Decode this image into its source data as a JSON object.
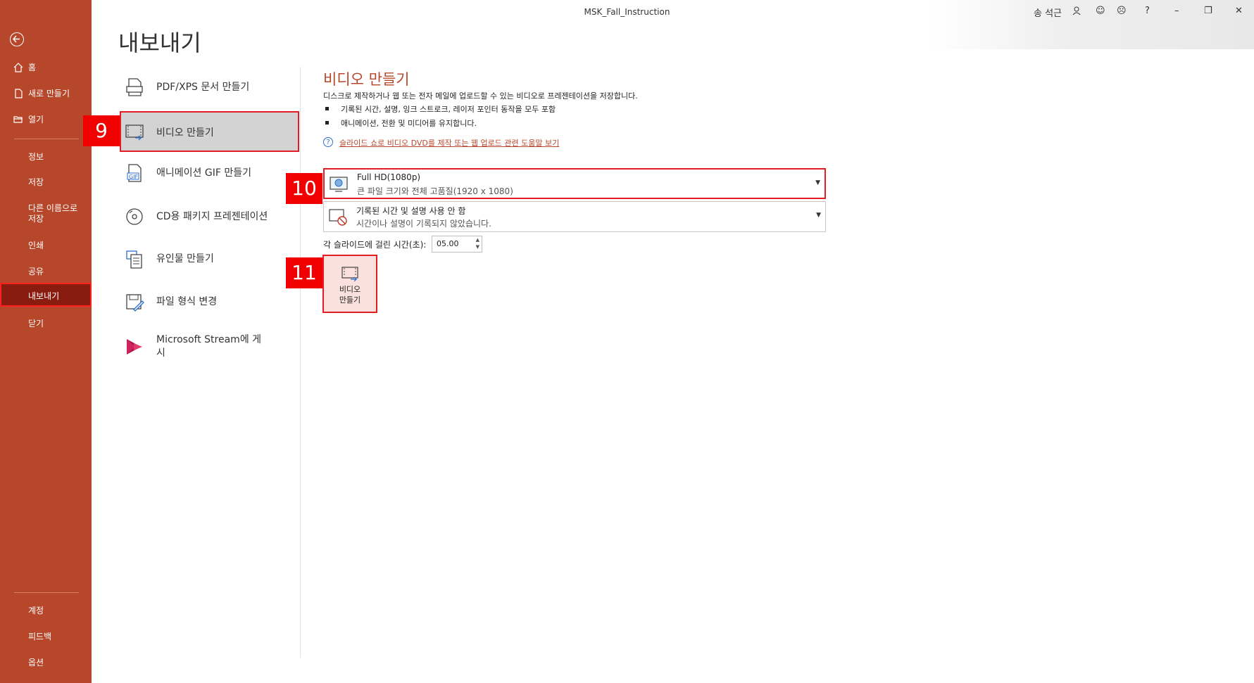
{
  "window": {
    "title": "MSK_Fall_Instruction",
    "user": "송 석근"
  },
  "sidebar": {
    "items": [
      {
        "label": "홈"
      },
      {
        "label": "새로 만들기"
      },
      {
        "label": "열기"
      },
      {
        "label": "정보"
      },
      {
        "label": "저장"
      },
      {
        "label": "다른 이름으로 저장"
      },
      {
        "label": "인쇄"
      },
      {
        "label": "공유"
      },
      {
        "label": "내보내기"
      },
      {
        "label": "닫기"
      }
    ],
    "bottom_items": [
      {
        "label": "계정"
      },
      {
        "label": "피드백"
      },
      {
        "label": "옵션"
      }
    ],
    "active": "내보내기"
  },
  "page": {
    "title": "내보내기"
  },
  "export_options": [
    {
      "label": "PDF/XPS 문서 만들기",
      "icon": "pdf-icon"
    },
    {
      "label": "비디오 만들기",
      "icon": "video-icon"
    },
    {
      "label": "애니메이션 GIF 만들기",
      "icon": "gif-icon"
    },
    {
      "label": "CD용 패키지 프레젠테이션",
      "icon": "cd-icon"
    },
    {
      "label": "유인물 만들기",
      "icon": "handout-icon"
    },
    {
      "label": "파일 형식 변경",
      "icon": "file-type-icon"
    },
    {
      "label": "Microsoft Stream에 게시",
      "icon": "stream-icon"
    }
  ],
  "markers": {
    "m9": "9",
    "m10": "10",
    "m11": "11"
  },
  "video": {
    "title": "비디오 만들기",
    "description": "디스크로 제작하거나 웹 또는 전자 메일에 업로드할 수 있는 비디오로 프레젠테이션을 저장합니다.",
    "bullets": [
      "기록된 시간, 설명, 잉크 스트로크, 레이저 포인터 동작을 모두 포함",
      "애니메이션, 전환 및 미디어를 유지합니다."
    ],
    "help_link": "슬라이드 쇼로 비디오 DVD를 제작 또는 웹 업로드 관련 도움말 보기",
    "quality": {
      "title": "Full HD(1080p)",
      "subtitle": "큰 파일 크기와 전체 고품질(1920 x 1080)"
    },
    "timings": {
      "title": "기록된 시간 및 설명 사용 안 함",
      "subtitle": "시간이나 설명이 기록되지 않았습니다."
    },
    "seconds_label": "각 슬라이드에 걸린 시간(초):",
    "seconds_value": "05.00",
    "make_button": "비디오 만들기"
  },
  "colors": {
    "accent": "#b7472a",
    "highlight": "#e31d24"
  }
}
